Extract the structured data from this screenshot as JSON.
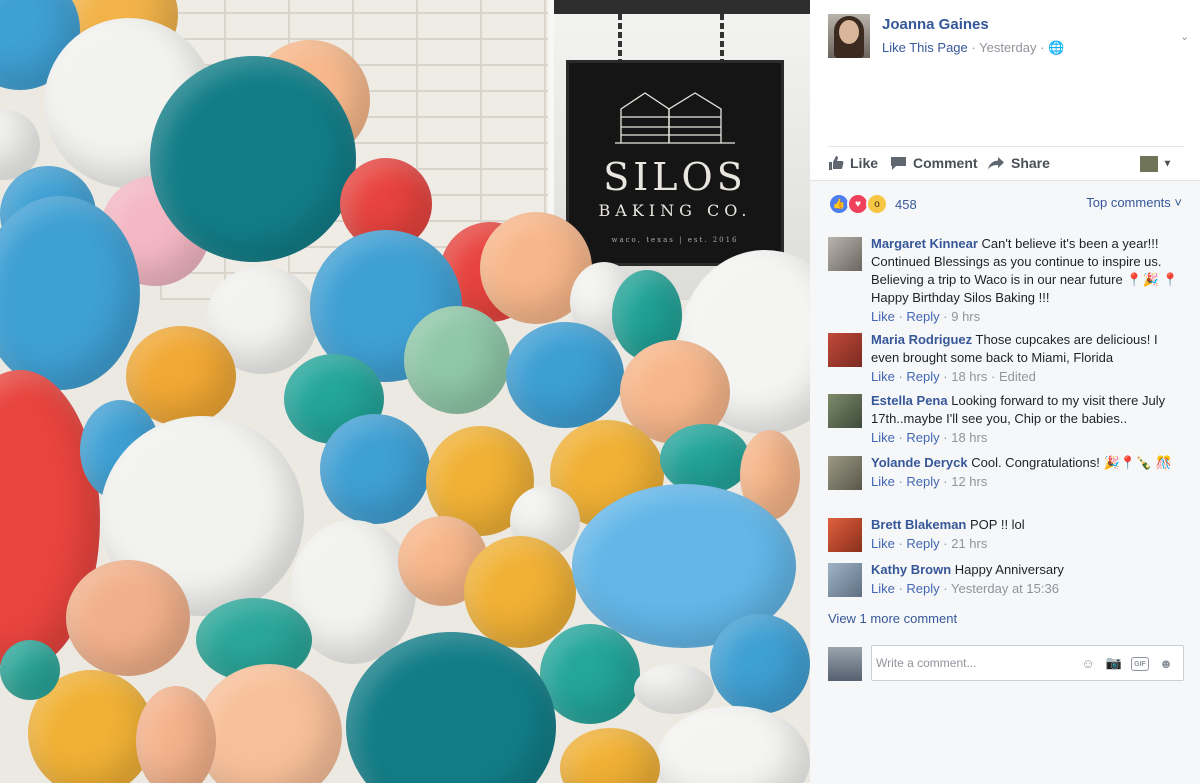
{
  "photo": {
    "sign_line1": "SILOS",
    "sign_line2": "BAKING CO.",
    "sign_line3": "waco, texas  |  est. 2016"
  },
  "post": {
    "page_name": "Joanna Gaines",
    "like_page": "Like This Page",
    "separator": "·",
    "time": "Yesterday",
    "chevron": "⌄"
  },
  "actions": {
    "like": "Like",
    "comment": "Comment",
    "share": "Share"
  },
  "reactions": {
    "count": "458",
    "top_comments": "Top comments ˅"
  },
  "comments": [
    {
      "name": "Margaret Kinnear",
      "text": "Can't believe it's been a year!!! Continued Blessings as you continue to inspire us. Believing a trip to Waco is in our near future 📍🎉 📍 Happy Birthday Silos Baking !!!",
      "like": "Like",
      "reply": "Reply",
      "time": "9 hrs",
      "edited": ""
    },
    {
      "name": "Maria Rodriguez",
      "text": "Those cupcakes are delicious! I even brought some back to Miami, Florida",
      "like": "Like",
      "reply": "Reply",
      "time": "18 hrs",
      "edited": "Edited"
    },
    {
      "name": "Estella Pena",
      "text": "Looking forward to my visit there July 17th..maybe I'll see you, Chip or the babies..",
      "like": "Like",
      "reply": "Reply",
      "time": "18 hrs",
      "edited": ""
    },
    {
      "name": "Yolande Deryck",
      "text": "Cool. Congratulations! 🎉📍🍾 🎊",
      "like": "Like",
      "reply": "Reply",
      "time": "12 hrs",
      "edited": ""
    },
    {
      "name": "Brett Blakeman",
      "text": "POP !! lol",
      "like": "Like",
      "reply": "Reply",
      "time": "21 hrs",
      "edited": ""
    },
    {
      "name": "Kathy Brown",
      "text": "Happy Anniversary",
      "like": "Like",
      "reply": "Reply",
      "time": "Yesterday at 15:36",
      "edited": ""
    }
  ],
  "view_more": "View 1 more comment",
  "composer": {
    "placeholder": "Write a comment..."
  },
  "colors": {
    "link": "#365899",
    "meta": "#90949c",
    "comment_bg": "#f6f7f9"
  }
}
